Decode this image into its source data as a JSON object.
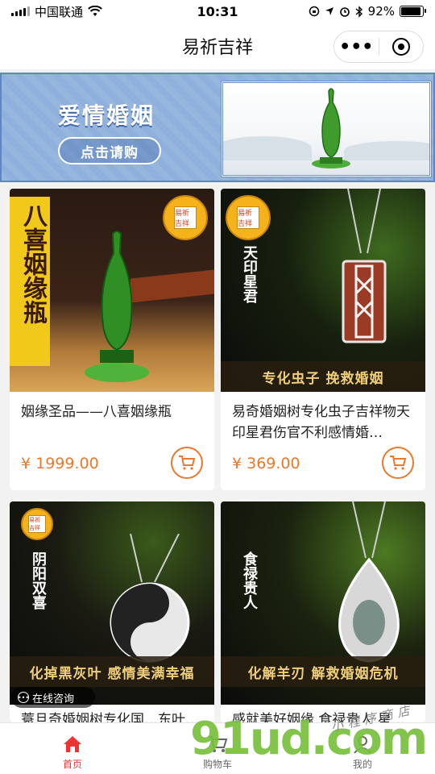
{
  "status_bar": {
    "carrier": "中国联通",
    "time": "10:31",
    "battery_percent": "92%",
    "battery_level": 0.92
  },
  "nav": {
    "title": "易祈吉祥",
    "more_icon": "ellipsis-icon",
    "close_icon": "target-circle-icon"
  },
  "banner": {
    "title": "爱情婚姻",
    "button_label": "点击请购",
    "colors": {
      "background": "#8fb0dc",
      "border": "#5f86c4"
    }
  },
  "products": [
    {
      "name": "姻缘圣品——八喜姻缘瓶",
      "price": "¥ 1999.00",
      "vertical_text": "八喜姻缘瓶",
      "caption": "",
      "seal": "易祈吉祥"
    },
    {
      "name": "易奇婚姻树专化虫子吉祥物天印星君伤官不利感情婚…",
      "price": "¥ 369.00",
      "vertical_text": "天印星君",
      "caption": "专化虫子  挽救婚姻",
      "seal": "易祈吉祥"
    },
    {
      "name": "蓑旦奇婚姻树专化国…东叶…",
      "price": "",
      "vertical_text": "阴阳双喜",
      "caption": "化掉黑灰叶  感情美满幸福",
      "seal": "易祈吉祥"
    },
    {
      "name": "感就美好姻缘 食禄贵人 星…",
      "price": "",
      "vertical_text": "食禄贵人",
      "caption": "化解羊刃  解救婚姻危机",
      "seal": ""
    }
  ],
  "consult": {
    "label": "在线咨询"
  },
  "tabs": [
    {
      "label": "首页",
      "icon": "home-icon",
      "active": true
    },
    {
      "label": "购物车",
      "icon": "cart-icon",
      "active": false
    },
    {
      "label": "我的",
      "icon": "user-icon",
      "active": false
    }
  ],
  "watermark": {
    "text": "91ud.com",
    "handwriting": "小程序商店"
  },
  "colors": {
    "accent": "#e8792e",
    "active_tab": "#ee3333",
    "caption_text": "#f0cf7a"
  }
}
